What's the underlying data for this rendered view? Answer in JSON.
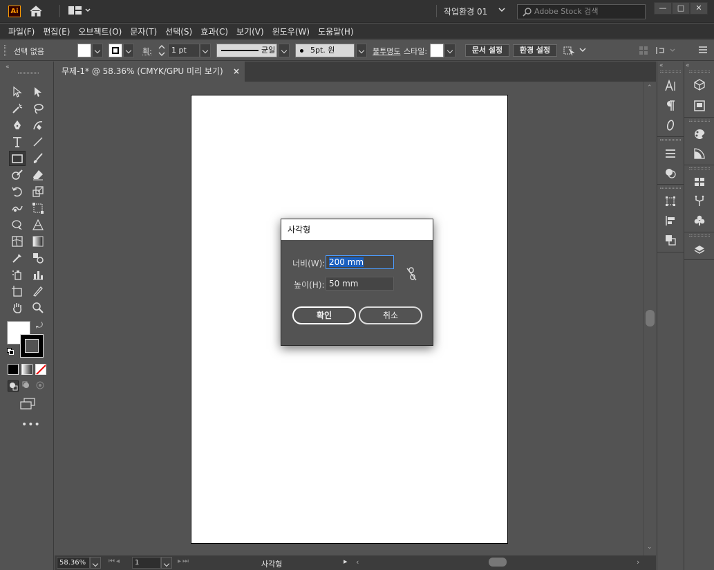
{
  "app": {
    "logo": "Ai",
    "workspace": "작업환경 01",
    "search_placeholder": "Adobe Stock 검색"
  },
  "menu": [
    "파일(F)",
    "편집(E)",
    "오브젝트(O)",
    "문자(T)",
    "선택(S)",
    "효과(C)",
    "보기(V)",
    "윈도우(W)",
    "도움말(H)"
  ],
  "control": {
    "selection": "선택 없음",
    "stroke_label": "획:",
    "stroke_weight": "1 pt",
    "stroke_profile": "균일",
    "brush": "5pt. 원",
    "opacity_label": "불투명도",
    "style_label": "스타일:",
    "doc_setup": "문서 설정",
    "preferences": "환경 설정"
  },
  "document": {
    "tab_title": "무제-1* @ 58.36% (CMYK/GPU 미리 보기)",
    "close": "×"
  },
  "status": {
    "zoom": "58.36%",
    "artboard_num": "1",
    "tool": "사각형"
  },
  "dialog": {
    "title": "사각형",
    "width_label": "너비(W):",
    "width_value": "200 mm",
    "height_label": "높이(H):",
    "height_value": "50 mm",
    "ok": "확인",
    "cancel": "취소"
  },
  "colors": {
    "chrome": "#323232",
    "panel": "#535353",
    "accent": "#4c9cff",
    "logo": "#ff9a00"
  }
}
